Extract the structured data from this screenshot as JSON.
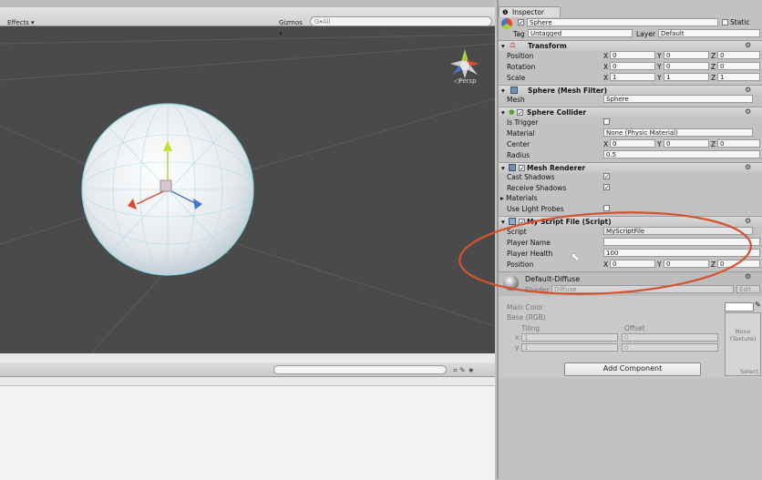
{
  "scene": {
    "effects_label": "Effects",
    "gizmos_label": "Gizmos",
    "search_placeholder": "G▾All",
    "persp_label": "◁Persp"
  },
  "inspector": {
    "tab_label": "Inspector",
    "object_name": "Sphere",
    "static_label": "Static",
    "tag_label": "Tag",
    "tag_value": "Untagged",
    "layer_label": "Layer",
    "layer_value": "Default",
    "transform": {
      "title": "Transform",
      "position_label": "Position",
      "rotation_label": "Rotation",
      "scale_label": "Scale",
      "position": {
        "x": "0",
        "y": "0",
        "z": "0"
      },
      "rotation": {
        "x": "0",
        "y": "0",
        "z": "0"
      },
      "scale": {
        "x": "1",
        "y": "1",
        "z": "1"
      }
    },
    "mesh_filter": {
      "title": "Sphere (Mesh Filter)",
      "mesh_label": "Mesh",
      "mesh_value": "Sphere"
    },
    "collider": {
      "title": "Sphere Collider",
      "is_trigger_label": "Is Trigger",
      "material_label": "Material",
      "material_value": "None (Physic Material)",
      "center_label": "Center",
      "center": {
        "x": "0",
        "y": "0",
        "z": "0"
      },
      "radius_label": "Radius",
      "radius_value": "0.5"
    },
    "mesh_renderer": {
      "title": "Mesh Renderer",
      "cast_shadows_label": "Cast Shadows",
      "receive_shadows_label": "Receive Shadows",
      "materials_label": "Materials",
      "light_probes_label": "Use Light Probes"
    },
    "script": {
      "title": "My Script File (Script)",
      "script_label": "Script",
      "script_value": "MyScriptFile",
      "player_name_label": "Player Name",
      "player_name_value": "",
      "player_health_label": "Player Health",
      "player_health_value": "100",
      "position_label": "Position",
      "position": {
        "x": "0",
        "y": "0",
        "z": "0"
      }
    },
    "material": {
      "name": "Default-Diffuse",
      "shader_label": "Shader",
      "shader_value": "Diffuse",
      "edit_label": "Edit...",
      "main_color_label": "Main Color",
      "base_label": "Base (RGB)",
      "tiling_label": "Tiling",
      "offset_label": "Offset",
      "tiling_x": "1",
      "tiling_y": "1",
      "offset_x": "0",
      "offset_y": "0",
      "texture_none": "None",
      "texture_label": "(Texture)",
      "select_label": "Select"
    },
    "add_component_label": "Add Component"
  },
  "colors": {
    "highlight_ellipse": "#d5532f",
    "scene_bg": "#4a4a4a",
    "inspector_bg": "#c2c2c2"
  }
}
